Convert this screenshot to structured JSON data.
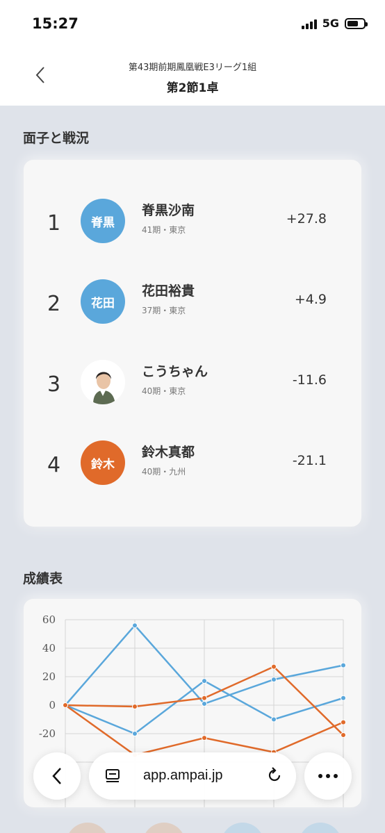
{
  "status_bar": {
    "time": "15:27",
    "network": "5G"
  },
  "header": {
    "subtitle": "第43期前期鳳凰戦E3リーグ1組",
    "title": "第2節1卓",
    "back_icon": "chevron-left-icon"
  },
  "standings": {
    "section_title": "面子と戦況",
    "players": [
      {
        "rank": "1",
        "avatar_text": "脊黒",
        "avatar_color": "#5aa7db",
        "name": "脊黒沙南",
        "meta": "41期・東京",
        "score": "+27.8"
      },
      {
        "rank": "2",
        "avatar_text": "花田",
        "avatar_color": "#5aa7db",
        "name": "花田裕貴",
        "meta": "37期・東京",
        "score": "+4.9"
      },
      {
        "rank": "3",
        "avatar_text": "",
        "avatar_color": "#ffffff",
        "name": "こうちゃん",
        "meta": "40期・東京",
        "score": "-11.6"
      },
      {
        "rank": "4",
        "avatar_text": "鈴木",
        "avatar_color": "#e06a2a",
        "name": "鈴木真都",
        "meta": "40期・九州",
        "score": "-21.1"
      }
    ]
  },
  "results": {
    "section_title": "成績表"
  },
  "chart_data": {
    "type": "line",
    "x": [
      0,
      1,
      2,
      3,
      4
    ],
    "ylim": [
      -40,
      60
    ],
    "yticks": [
      "60",
      "40",
      "20",
      "0",
      "-20"
    ],
    "grid": true,
    "series": [
      {
        "color": "#5aa7db",
        "values": [
          0,
          56,
          1,
          18,
          28
        ]
      },
      {
        "color": "#5aa7db",
        "values": [
          0,
          -20,
          17,
          -10,
          5
        ]
      },
      {
        "color": "#e06a2a",
        "values": [
          0,
          -1,
          5,
          27,
          -21
        ]
      },
      {
        "color": "#e06a2a",
        "values": [
          0,
          -35,
          -23,
          -33,
          -12
        ]
      }
    ]
  },
  "browser": {
    "url": "app.ampai.jp",
    "back_icon": "chevron-left-icon",
    "reader_icon": "reader-mode-icon",
    "reload_icon": "reload-icon",
    "more_icon": "more-icon"
  },
  "colors": {
    "blue": "#5aa7db",
    "orange": "#e06a2a",
    "background": "#dfe3ea"
  }
}
